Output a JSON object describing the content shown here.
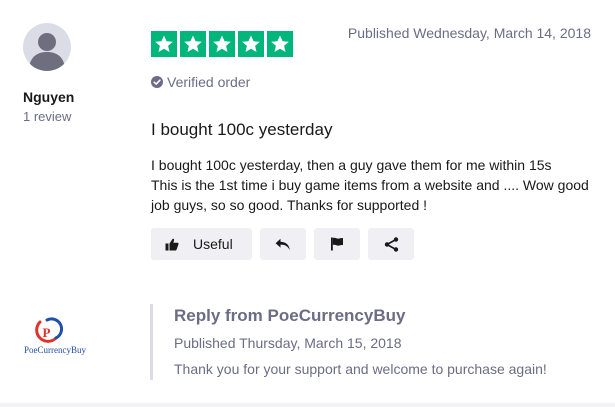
{
  "reviewer": {
    "name": "Nguyen",
    "review_count": "1 review",
    "avatar_icon": "user-silhouette-icon"
  },
  "review": {
    "rating": 5,
    "rating_max": 5,
    "star_color": "#00b67a",
    "published": "Published Wednesday, March 14, 2018",
    "verified_label": "Verified order",
    "title": "I bought 100c yesterday",
    "body_lines": [
      "I bought 100c yesterday, then a guy gave them for me within 15s",
      "This is the 1st time i buy game items from a website and .... Wow good job guys, so so good. Thanks for supported !"
    ]
  },
  "actions": {
    "useful_label": "Useful",
    "useful_icon": "thumbs-up-icon",
    "reply_icon": "reply-arrow-icon",
    "flag_icon": "flag-icon",
    "share_icon": "share-icon"
  },
  "company_reply": {
    "logo_text": "PoeCurrencyBuy",
    "title": "Reply from PoeCurrencyBuy",
    "published": "Published Thursday, March 15, 2018",
    "text": "Thank you for your support and welcome to purchase again!"
  }
}
